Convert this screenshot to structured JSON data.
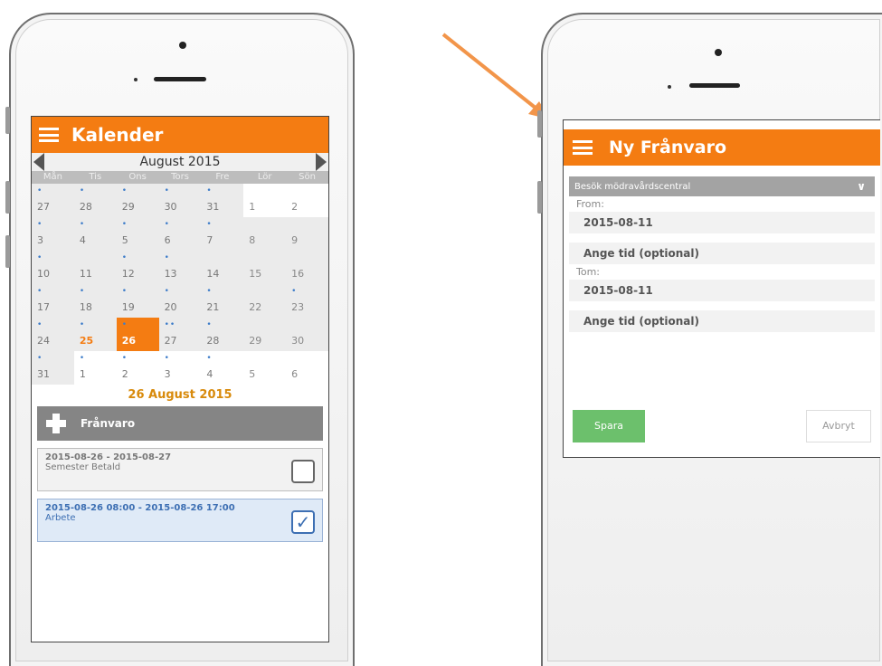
{
  "left_phone": {
    "app_title": "Kalender",
    "month_label": "August 2015",
    "weekdays": [
      "Mån",
      "Tis",
      "Ons",
      "Tors",
      "Fre",
      "Lör",
      "Sön"
    ],
    "weeks": [
      [
        {
          "d": "27",
          "in": true,
          "dot": "•"
        },
        {
          "d": "28",
          "in": true,
          "dot": "•"
        },
        {
          "d": "29",
          "in": true,
          "dot": "•"
        },
        {
          "d": "30",
          "in": true,
          "dot": "•"
        },
        {
          "d": "31",
          "in": true,
          "dot": "•"
        },
        {
          "d": "1",
          "in": false,
          "dot": ""
        },
        {
          "d": "2",
          "in": false,
          "dot": ""
        }
      ],
      [
        {
          "d": "3",
          "in": true,
          "dot": "•"
        },
        {
          "d": "4",
          "in": true,
          "dot": "•"
        },
        {
          "d": "5",
          "in": true,
          "dot": "•"
        },
        {
          "d": "6",
          "in": true,
          "dot": "•"
        },
        {
          "d": "7",
          "in": true,
          "dot": "•"
        },
        {
          "d": "8",
          "in": true,
          "dot": ""
        },
        {
          "d": "9",
          "in": true,
          "dot": ""
        }
      ],
      [
        {
          "d": "10",
          "in": true,
          "dot": "•"
        },
        {
          "d": "11",
          "in": true,
          "dot": ""
        },
        {
          "d": "12",
          "in": true,
          "dot": "•"
        },
        {
          "d": "13",
          "in": true,
          "dot": "•"
        },
        {
          "d": "14",
          "in": true,
          "dot": ""
        },
        {
          "d": "15",
          "in": true,
          "dot": ""
        },
        {
          "d": "16",
          "in": true,
          "dot": ""
        }
      ],
      [
        {
          "d": "17",
          "in": true,
          "dot": "•"
        },
        {
          "d": "18",
          "in": true,
          "dot": "•"
        },
        {
          "d": "19",
          "in": true,
          "dot": "•"
        },
        {
          "d": "20",
          "in": true,
          "dot": "•"
        },
        {
          "d": "21",
          "in": true,
          "dot": "•"
        },
        {
          "d": "22",
          "in": true,
          "dot": ""
        },
        {
          "d": "23",
          "in": true,
          "dot": "•"
        }
      ],
      [
        {
          "d": "24",
          "in": true,
          "dot": "•"
        },
        {
          "d": "25",
          "in": true,
          "dot": "•",
          "mark": true
        },
        {
          "d": "26",
          "in": true,
          "dot": "•",
          "today": true
        },
        {
          "d": "27",
          "in": true,
          "dot": "••"
        },
        {
          "d": "28",
          "in": true,
          "dot": "•"
        },
        {
          "d": "29",
          "in": true,
          "dot": ""
        },
        {
          "d": "30",
          "in": true,
          "dot": ""
        }
      ],
      [
        {
          "d": "31",
          "in": true,
          "dot": "•"
        },
        {
          "d": "1",
          "in": false,
          "dot": "•"
        },
        {
          "d": "2",
          "in": false,
          "dot": "•"
        },
        {
          "d": "3",
          "in": false,
          "dot": "•"
        },
        {
          "d": "4",
          "in": false,
          "dot": "•"
        },
        {
          "d": "5",
          "in": false,
          "dot": ""
        },
        {
          "d": "6",
          "in": false,
          "dot": ""
        }
      ]
    ],
    "selected_date": "26 August 2015",
    "add_label": "Frånvaro",
    "entries": [
      {
        "line1": "2015-08-26 - 2015-08-27",
        "line2": "Semester Betald",
        "checked": false
      },
      {
        "line1": "2015-08-26 08:00 - 2015-08-26 17:00",
        "line2": "Arbete",
        "checked": true
      }
    ]
  },
  "right_phone": {
    "app_title": "Ny Frånvaro",
    "type_select": "Besök mödravårdscentral",
    "from_label": "From:",
    "from_date": "2015-08-11",
    "from_time": "Ange tid (optional)",
    "tom_label": "Tom:",
    "tom_date": "2015-08-11",
    "tom_time": "Ange tid (optional)",
    "save_label": "Spara",
    "cancel_label": "Avbryt"
  },
  "colors": {
    "accent": "#f47c12",
    "save": "#6cc06c",
    "arrow": "#f2954a",
    "dot": "#3d7cc9"
  }
}
